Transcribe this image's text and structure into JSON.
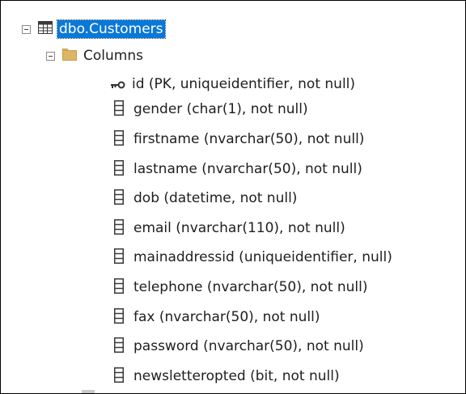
{
  "tree": {
    "table": {
      "icon": "table-icon",
      "label": "dbo.Customers",
      "selected": true,
      "expanded": true
    },
    "columns_folder": {
      "icon": "folder-icon",
      "label": "Columns",
      "expanded": true
    },
    "columns": [
      {
        "icon": "key-icon",
        "label": "id (PK, uniqueidentifier, not null)"
      },
      {
        "icon": "column-icon",
        "label": "gender (char(1), not null)"
      },
      {
        "icon": "column-icon",
        "label": "firstname (nvarchar(50), not null)"
      },
      {
        "icon": "column-icon",
        "label": "lastname (nvarchar(50), not null)"
      },
      {
        "icon": "column-icon",
        "label": "dob (datetime, not null)"
      },
      {
        "icon": "column-icon",
        "label": "email (nvarchar(110), not null)"
      },
      {
        "icon": "column-icon",
        "label": "mainaddressid (uniqueidentifier, null)"
      },
      {
        "icon": "column-icon",
        "label": "telephone (nvarchar(50), not null)"
      },
      {
        "icon": "column-icon",
        "label": "fax (nvarchar(50), not null)"
      },
      {
        "icon": "column-icon",
        "label": "password (nvarchar(50), not null)"
      },
      {
        "icon": "column-icon",
        "label": "newsletteropted (bit, not null)"
      }
    ]
  },
  "colors": {
    "selection": "#0a78d7",
    "folder": "#dcb567",
    "text": "#1e1e1e"
  }
}
